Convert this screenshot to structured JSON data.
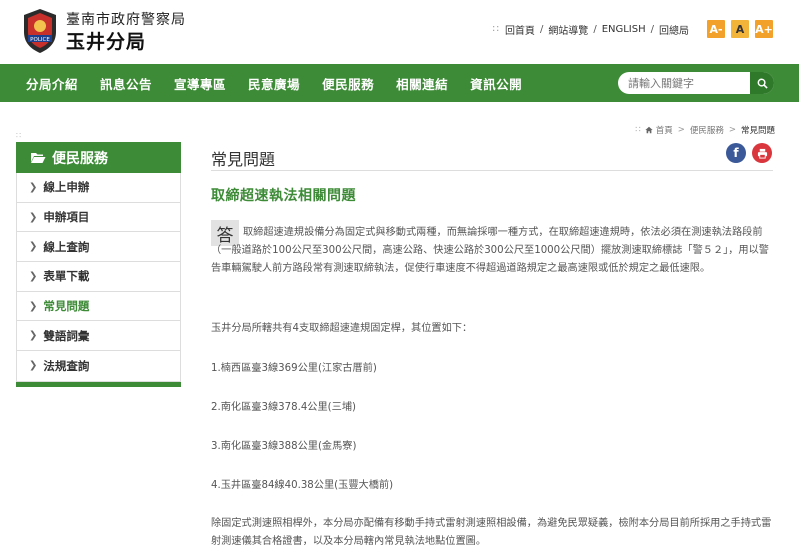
{
  "header": {
    "org_line1": "臺南市政府警察局",
    "org_line2": "玉井分局",
    "logo_badge_text": "POLICE",
    "toplinks": [
      "回首頁",
      "網站導覽",
      "ENGLISH",
      "回總局"
    ],
    "font_sizes": [
      "A-",
      "A",
      "A+"
    ],
    "accent_color": "#f2a22a"
  },
  "nav": {
    "items": [
      "分局介紹",
      "訊息公告",
      "宣導專區",
      "民意廣場",
      "便民服務",
      "相關連結",
      "資訊公開"
    ],
    "search_placeholder": "請輸入關鍵字",
    "color": "#3d8b37"
  },
  "sidebar": {
    "title": "便民服務",
    "items": [
      {
        "label": "線上申辦"
      },
      {
        "label": "申辦項目"
      },
      {
        "label": "線上查詢"
      },
      {
        "label": "表單下載"
      },
      {
        "label": "常見問題",
        "active": true
      },
      {
        "label": "雙語詞彙"
      },
      {
        "label": "法規查詢"
      }
    ]
  },
  "breadcrumb": [
    "首頁",
    "便民服務",
    "常見問題"
  ],
  "main": {
    "page_title": "常見問題",
    "question_title": "取締超速執法相關問題",
    "answer_badge": "答",
    "paragraphs": [
      "取締超速違規設備分為固定式與移動式兩種，而無論採哪一種方式，在取締超速違規時，依法必須在測速執法路段前（一般道路於100公尺至300公尺間，高速公路、快速公路於300公尺至1000公尺間）擺放測速取締標誌「警５２」，用以警告車輛駕駛人前方路段常有測速取締執法，促使行車速度不得超過道路規定之最高速限或低於規定之最低速限。",
      "玉井分局所轄共有4支取締超速違規固定桿，其位置如下：",
      "1.楠西區臺3線369公里(江家古厝前)",
      "2.南化區臺3線378.4公里(三埔)",
      "3.南化區臺3線388公里(金馬寮)",
      "4.玉井區臺84線40.38公里(玉豐大橋前)",
      "除固定式測速照相桿外，本分局亦配備有移動手持式雷射測速照相設備，為避免民眾疑義，檢附本分局目前所採用之手持式雷射測速儀其合格證書，以及本分局轄內常見執法地點位置圖。"
    ]
  }
}
